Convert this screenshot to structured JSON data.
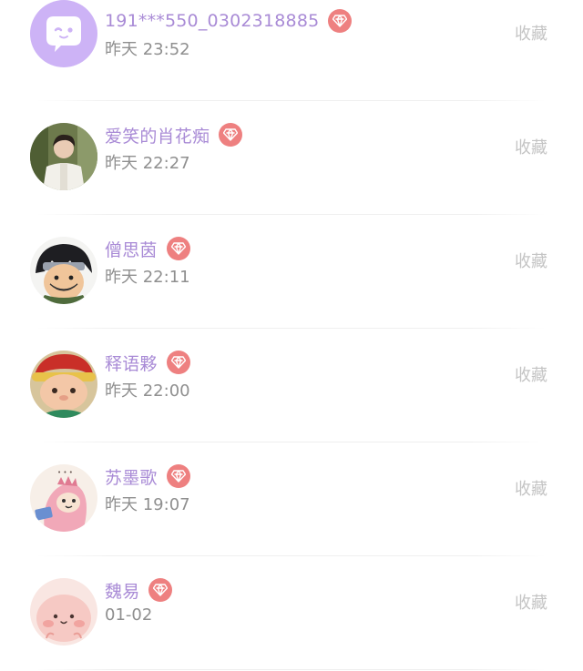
{
  "messages": [
    {
      "name": "191***550_0302318885",
      "time": "昨天 23:52",
      "action": "收藏",
      "avatar": "robot-face-avatar"
    },
    {
      "name": "爱笑的肖花痴",
      "time": "昨天 22:27",
      "action": "收藏",
      "avatar": "man-photo-avatar"
    },
    {
      "name": "僧思茵",
      "time": "昨天 22:11",
      "action": "收藏",
      "avatar": "anime-ninja-avatar"
    },
    {
      "name": "释语夥",
      "time": "昨天 22:00",
      "action": "收藏",
      "avatar": "cartoon-boy-avatar"
    },
    {
      "name": "苏墨歌",
      "time": "昨天 19:07",
      "action": "收藏",
      "avatar": "pink-dino-avatar"
    },
    {
      "name": "魏易",
      "time": "01-02",
      "action": "收藏",
      "avatar": "pink-blob-avatar"
    }
  ],
  "colors": {
    "name": "#a98bd6",
    "time": "#8f8f8f",
    "action": "#c4c4c4",
    "badge": "#ee8080"
  }
}
